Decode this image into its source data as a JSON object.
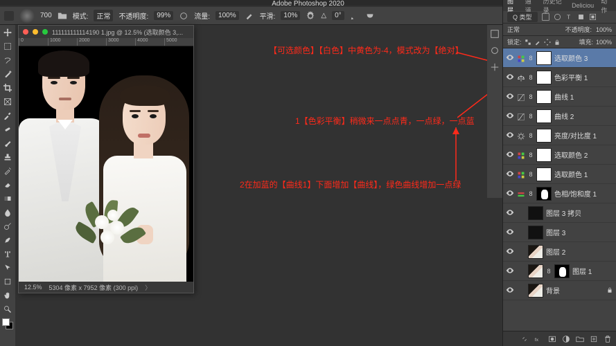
{
  "app_title": "Adobe Photoshop 2020",
  "options_bar": {
    "brush_size": "700",
    "mode_label": "模式:",
    "mode_value": "正常",
    "opacity_label": "不透明度:",
    "opacity_value": "99%",
    "flow_label": "流量:",
    "flow_value": "100%",
    "smooth_label": "平滑:",
    "smooth_value": "10%",
    "angle_label": "△",
    "angle_value": "0°"
  },
  "document": {
    "tab_title": "111111111114190 1.jpg @ 12.5% (选取颜色 3,...",
    "ruler_marks": [
      "0",
      "1000",
      "2000",
      "3000",
      "4000",
      "5000"
    ],
    "zoom": "12.5%",
    "dims": "5304 像素 x 7952 像素 (300 ppi)"
  },
  "annotations": {
    "a1": "【可选颜色】【白色】中黄色为-4，模式改为【绝对】",
    "a2": "1【色彩平衡】稍微来一点点青，一点绿，一点蓝",
    "a3": "2在加蓝的【曲线1】下面增加【曲线】，绿色曲线增加一点绿"
  },
  "layers_panel": {
    "tabs": [
      "图层",
      "通道",
      "历史记录",
      "Deliciou",
      "动作"
    ],
    "filter_kind": "Q 类型",
    "blend_mode": "正常",
    "opacity_label": "不透明度:",
    "opacity_value": "100%",
    "lock_label": "锁定:",
    "fill_label": "填充:",
    "fill_value": "100%",
    "layers": [
      {
        "name": "选取颜色 3",
        "type": "adj",
        "icon": "sel-color",
        "mask": "white",
        "selected": true
      },
      {
        "name": "色彩平衡 1",
        "type": "adj",
        "icon": "balance",
        "mask": "white"
      },
      {
        "name": "曲线 1",
        "type": "adj",
        "icon": "curves",
        "mask": "white"
      },
      {
        "name": "曲线 2",
        "type": "adj",
        "icon": "curves",
        "mask": "white"
      },
      {
        "name": "亮度/对比度 1",
        "type": "adj",
        "icon": "bright",
        "mask": "white"
      },
      {
        "name": "选取颜色 2",
        "type": "adj",
        "icon": "sel-color",
        "mask": "white"
      },
      {
        "name": "选取颜色 1",
        "type": "adj",
        "icon": "sel-color",
        "mask": "white"
      },
      {
        "name": "色相/饱和度 1",
        "type": "adj",
        "icon": "hue",
        "mask": "shape"
      },
      {
        "name": "图层 3 拷贝",
        "type": "pixel",
        "thumb": "dark"
      },
      {
        "name": "图层 3",
        "type": "pixel",
        "thumb": "dark"
      },
      {
        "name": "图层 2",
        "type": "pixel",
        "thumb": "photo"
      },
      {
        "name": "图层 1",
        "type": "pixel",
        "thumb": "photo",
        "mask": "shape"
      },
      {
        "name": "背景",
        "type": "pixel",
        "thumb": "photo",
        "locked": true
      }
    ],
    "foot_icons": [
      "link",
      "fx",
      "mask",
      "adjust",
      "group",
      "new",
      "trash"
    ]
  },
  "tools": [
    "move",
    "marquee",
    "lasso",
    "wand",
    "crop",
    "frame",
    "eyedrop",
    "heal",
    "brush",
    "stamp",
    "history",
    "eraser",
    "gradient",
    "blur",
    "dodge",
    "pen",
    "type",
    "path",
    "shape",
    "hand",
    "zoom"
  ]
}
